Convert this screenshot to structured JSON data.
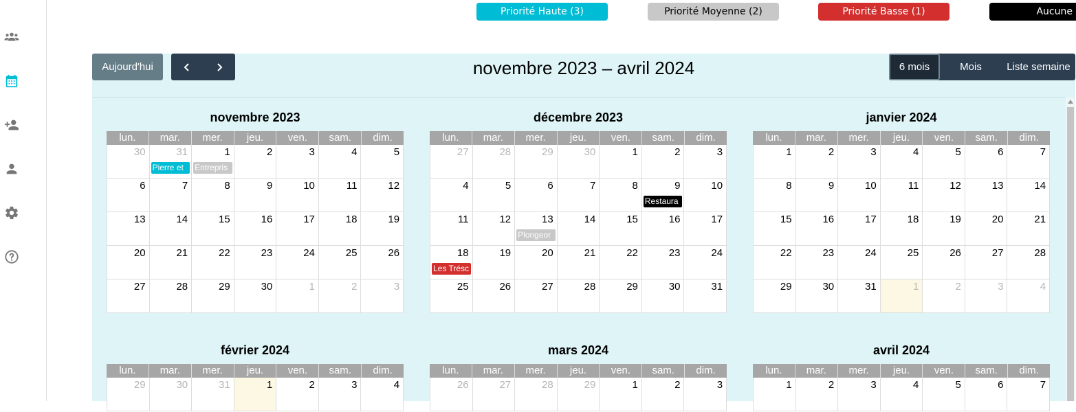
{
  "sidebar": {
    "icons": [
      "users-icon",
      "calendar-icon",
      "add-user-icon",
      "user-icon",
      "settings-icon",
      "help-icon"
    ],
    "active_color": "#00bcd4",
    "icon_color": "#777777"
  },
  "legend": [
    {
      "label": "Priorité Haute (3)",
      "bg": "#00bcd4",
      "fg": "#ffffff"
    },
    {
      "label": "Priorité Moyenne (2)",
      "bg": "#c8c8c8",
      "fg": "#000000"
    },
    {
      "label": "Priorité Basse (1)",
      "bg": "#d32f2f",
      "fg": "#ffffff"
    },
    {
      "label": "Aucune",
      "bg": "#000000",
      "fg": "#ffffff"
    }
  ],
  "toolbar": {
    "today_label": "Aujourd'hui",
    "prev_icon": "chevron-left-icon",
    "next_icon": "chevron-right-icon",
    "title": "novembre 2023 – avril 2024",
    "views": [
      "6 mois",
      "Mois",
      "Liste semaine"
    ],
    "active_view": "6 mois"
  },
  "weekdays": [
    "lun.",
    "mar.",
    "mer.",
    "jeu.",
    "ven.",
    "sam.",
    "dim."
  ],
  "months": [
    {
      "title": "novembre 2023",
      "weeks": [
        [
          {
            "d": "30",
            "o": true
          },
          {
            "d": "31",
            "o": true
          },
          {
            "d": "1"
          },
          {
            "d": "2"
          },
          {
            "d": "3"
          },
          {
            "d": "4"
          },
          {
            "d": "5"
          }
        ],
        [
          {
            "d": "6"
          },
          {
            "d": "7"
          },
          {
            "d": "8"
          },
          {
            "d": "9"
          },
          {
            "d": "10"
          },
          {
            "d": "11"
          },
          {
            "d": "12"
          }
        ],
        [
          {
            "d": "13"
          },
          {
            "d": "14"
          },
          {
            "d": "15"
          },
          {
            "d": "16"
          },
          {
            "d": "17"
          },
          {
            "d": "18"
          },
          {
            "d": "19"
          }
        ],
        [
          {
            "d": "20"
          },
          {
            "d": "21"
          },
          {
            "d": "22"
          },
          {
            "d": "23"
          },
          {
            "d": "24"
          },
          {
            "d": "25"
          },
          {
            "d": "26"
          }
        ],
        [
          {
            "d": "27"
          },
          {
            "d": "28"
          },
          {
            "d": "29"
          },
          {
            "d": "30"
          },
          {
            "d": "1",
            "o": true
          },
          {
            "d": "2",
            "o": true
          },
          {
            "d": "3",
            "o": true
          }
        ]
      ]
    },
    {
      "title": "décembre 2023",
      "weeks": [
        [
          {
            "d": "27",
            "o": true
          },
          {
            "d": "28",
            "o": true
          },
          {
            "d": "29",
            "o": true
          },
          {
            "d": "30",
            "o": true
          },
          {
            "d": "1"
          },
          {
            "d": "2"
          },
          {
            "d": "3"
          }
        ],
        [
          {
            "d": "4"
          },
          {
            "d": "5"
          },
          {
            "d": "6"
          },
          {
            "d": "7"
          },
          {
            "d": "8"
          },
          {
            "d": "9"
          },
          {
            "d": "10"
          }
        ],
        [
          {
            "d": "11"
          },
          {
            "d": "12"
          },
          {
            "d": "13"
          },
          {
            "d": "14"
          },
          {
            "d": "15"
          },
          {
            "d": "16"
          },
          {
            "d": "17"
          }
        ],
        [
          {
            "d": "18"
          },
          {
            "d": "19"
          },
          {
            "d": "20"
          },
          {
            "d": "21"
          },
          {
            "d": "22"
          },
          {
            "d": "23"
          },
          {
            "d": "24"
          }
        ],
        [
          {
            "d": "25"
          },
          {
            "d": "26"
          },
          {
            "d": "27"
          },
          {
            "d": "28"
          },
          {
            "d": "29"
          },
          {
            "d": "30"
          },
          {
            "d": "31"
          }
        ]
      ]
    },
    {
      "title": "janvier 2024",
      "weeks": [
        [
          {
            "d": "1"
          },
          {
            "d": "2"
          },
          {
            "d": "3"
          },
          {
            "d": "4"
          },
          {
            "d": "5"
          },
          {
            "d": "6"
          },
          {
            "d": "7"
          }
        ],
        [
          {
            "d": "8"
          },
          {
            "d": "9"
          },
          {
            "d": "10"
          },
          {
            "d": "11"
          },
          {
            "d": "12"
          },
          {
            "d": "13"
          },
          {
            "d": "14"
          }
        ],
        [
          {
            "d": "15"
          },
          {
            "d": "16"
          },
          {
            "d": "17"
          },
          {
            "d": "18"
          },
          {
            "d": "19"
          },
          {
            "d": "20"
          },
          {
            "d": "21"
          }
        ],
        [
          {
            "d": "22"
          },
          {
            "d": "23"
          },
          {
            "d": "24"
          },
          {
            "d": "25"
          },
          {
            "d": "26"
          },
          {
            "d": "27"
          },
          {
            "d": "28"
          }
        ],
        [
          {
            "d": "29"
          },
          {
            "d": "30"
          },
          {
            "d": "31"
          },
          {
            "d": "1",
            "o": true,
            "today": true
          },
          {
            "d": "2",
            "o": true
          },
          {
            "d": "3",
            "o": true
          },
          {
            "d": "4",
            "o": true
          }
        ]
      ]
    },
    {
      "title": "février 2024",
      "weeks": [
        [
          {
            "d": "29",
            "o": true
          },
          {
            "d": "30",
            "o": true
          },
          {
            "d": "31",
            "o": true
          },
          {
            "d": "1",
            "today": true
          },
          {
            "d": "2"
          },
          {
            "d": "3"
          },
          {
            "d": "4"
          }
        ]
      ]
    },
    {
      "title": "mars 2024",
      "weeks": [
        [
          {
            "d": "26",
            "o": true
          },
          {
            "d": "27",
            "o": true
          },
          {
            "d": "28",
            "o": true
          },
          {
            "d": "29",
            "o": true
          },
          {
            "d": "1"
          },
          {
            "d": "2"
          },
          {
            "d": "3"
          }
        ]
      ]
    },
    {
      "title": "avril 2024",
      "weeks": [
        [
          {
            "d": "1"
          },
          {
            "d": "2"
          },
          {
            "d": "3"
          },
          {
            "d": "4"
          },
          {
            "d": "5"
          },
          {
            "d": "6"
          },
          {
            "d": "7"
          }
        ]
      ]
    }
  ],
  "events": [
    {
      "month": 0,
      "week": 0,
      "day": 1,
      "label": "Pierre et",
      "bg": "#00bcd4",
      "fg": "#ffffff"
    },
    {
      "month": 0,
      "week": 0,
      "day": 2,
      "label": "Entrepris",
      "bg": "#c8c8c8",
      "fg": "#ffffff"
    },
    {
      "month": 1,
      "week": 1,
      "day": 5,
      "label": "Restaura",
      "bg": "#000000",
      "fg": "#ffffff"
    },
    {
      "month": 1,
      "week": 2,
      "day": 2,
      "label": "Plongeor",
      "bg": "#c8c8c8",
      "fg": "#ffffff"
    },
    {
      "month": 1,
      "week": 3,
      "day": 0,
      "label": "Les Trésc",
      "bg": "#d32f2f",
      "fg": "#ffffff"
    }
  ]
}
